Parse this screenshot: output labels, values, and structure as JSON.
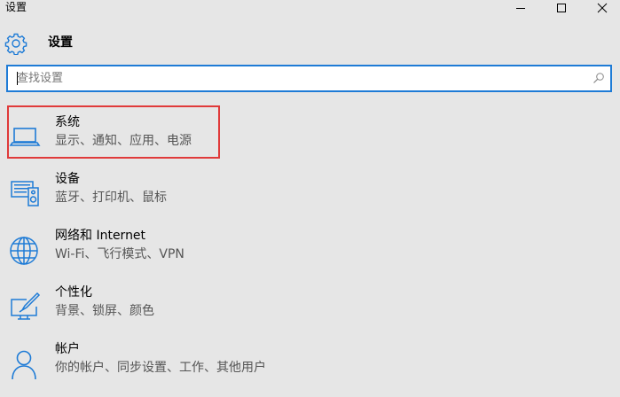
{
  "window": {
    "title": "设置",
    "controls": {
      "minimize": "minimize-icon",
      "maximize": "maximize-icon",
      "close": "close-icon"
    }
  },
  "header": {
    "title": "设置",
    "icon": "gear-icon"
  },
  "search": {
    "placeholder": "查找设置",
    "value": "",
    "icon": "search-icon"
  },
  "items": [
    {
      "title": "系统",
      "subtitle": "显示、通知、应用、电源",
      "icon": "laptop-icon",
      "highlighted": true
    },
    {
      "title": "设备",
      "subtitle": "蓝牙、打印机、鼠标",
      "icon": "devices-icon",
      "highlighted": false
    },
    {
      "title": "网络和 Internet",
      "subtitle": "Wi-Fi、飞行模式、VPN",
      "icon": "globe-icon",
      "highlighted": false
    },
    {
      "title": "个性化",
      "subtitle": "背景、锁屏、颜色",
      "icon": "personalization-icon",
      "highlighted": false
    },
    {
      "title": "帐户",
      "subtitle": "你的帐户、同步设置、工作、其他用户",
      "icon": "person-icon",
      "highlighted": false
    }
  ],
  "colors": {
    "accent": "#1e7bd6",
    "highlight_border": "#e03a3a",
    "background": "#e6e6e6"
  }
}
